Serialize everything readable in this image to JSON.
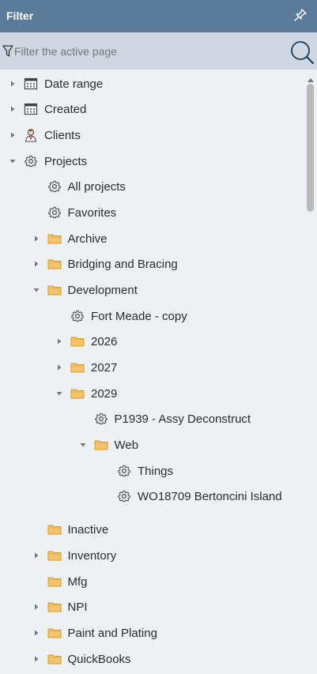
{
  "panel": {
    "title": "Filter"
  },
  "search": {
    "placeholder": "Filter the active page"
  },
  "tree": [
    {
      "label": "Date range",
      "icon": "calendar",
      "arrow": "right"
    },
    {
      "label": "Created",
      "icon": "calendar",
      "arrow": "right"
    },
    {
      "label": "Clients",
      "icon": "person",
      "arrow": "right"
    },
    {
      "label": "Projects",
      "icon": "gear",
      "arrow": "down"
    },
    {
      "label": "All projects",
      "icon": "gear",
      "arrow": "none"
    },
    {
      "label": "Favorites",
      "icon": "gear",
      "arrow": "none"
    },
    {
      "label": "Archive",
      "icon": "folder",
      "arrow": "right"
    },
    {
      "label": "Bridging and Bracing",
      "icon": "folder",
      "arrow": "right"
    },
    {
      "label": "Development",
      "icon": "folder",
      "arrow": "down"
    },
    {
      "label": "Fort Meade - copy",
      "icon": "gear",
      "arrow": "none"
    },
    {
      "label": "2026",
      "icon": "folder",
      "arrow": "right"
    },
    {
      "label": "2027",
      "icon": "folder",
      "arrow": "right"
    },
    {
      "label": "2029",
      "icon": "folder",
      "arrow": "down"
    },
    {
      "label": "P1939 - Assy Deconstruct",
      "icon": "gear",
      "arrow": "none"
    },
    {
      "label": "Web",
      "icon": "folder",
      "arrow": "down"
    },
    {
      "label": "Things",
      "icon": "gear",
      "arrow": "none"
    },
    {
      "label": "WO18709 Bertoncini Island",
      "icon": "gear",
      "arrow": "none"
    },
    {
      "label": "Inactive",
      "icon": "folder",
      "arrow": "none"
    },
    {
      "label": "Inventory",
      "icon": "folder",
      "arrow": "right"
    },
    {
      "label": "Mfg",
      "icon": "folder",
      "arrow": "none"
    },
    {
      "label": "NPI",
      "icon": "folder",
      "arrow": "right"
    },
    {
      "label": "Paint and Plating",
      "icon": "folder",
      "arrow": "right"
    },
    {
      "label": "QuickBooks",
      "icon": "folder",
      "arrow": "right"
    }
  ],
  "colors": {
    "header": "#5b7b9a",
    "search_bg": "#cdd8e2",
    "panel_bg": "#eef1f4",
    "folder": "#f5c46a"
  }
}
